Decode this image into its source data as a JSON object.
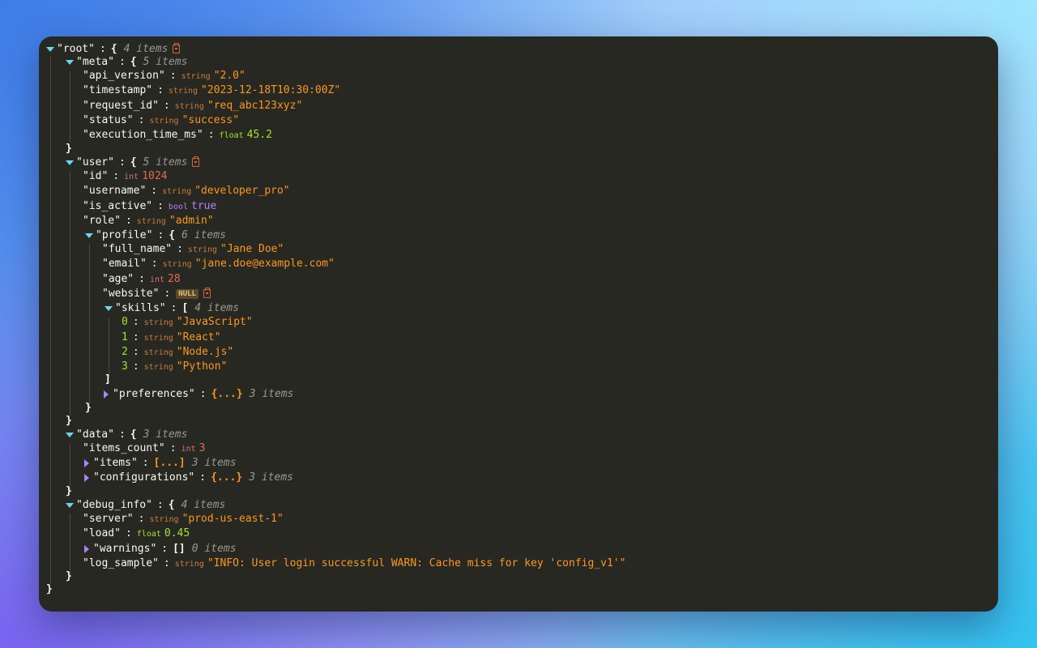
{
  "meta_counts": {
    "items_word": "items"
  },
  "root": {
    "key": "\"root\"",
    "open": "{",
    "close": "}",
    "count": "4 items"
  },
  "meta": {
    "key": "\"meta\"",
    "open": "{",
    "close": "}",
    "count": "5 items",
    "api_version": {
      "key": "\"api_version\"",
      "type": "string",
      "value": "\"2.0\""
    },
    "timestamp": {
      "key": "\"timestamp\"",
      "type": "string",
      "value": "\"2023-12-18T10:30:00Z\""
    },
    "request_id": {
      "key": "\"request_id\"",
      "type": "string",
      "value": "\"req_abc123xyz\""
    },
    "status": {
      "key": "\"status\"",
      "type": "string",
      "value": "\"success\""
    },
    "execution_time_ms": {
      "key": "\"execution_time_ms\"",
      "type": "float",
      "value": "45.2"
    }
  },
  "user": {
    "key": "\"user\"",
    "open": "{",
    "close": "}",
    "count": "5 items",
    "id": {
      "key": "\"id\"",
      "type": "int",
      "value": "1024"
    },
    "username": {
      "key": "\"username\"",
      "type": "string",
      "value": "\"developer_pro\""
    },
    "is_active": {
      "key": "\"is_active\"",
      "type": "bool",
      "value": "true"
    },
    "role": {
      "key": "\"role\"",
      "type": "string",
      "value": "\"admin\""
    },
    "profile": {
      "key": "\"profile\"",
      "open": "{",
      "close": "}",
      "count": "6 items",
      "full_name": {
        "key": "\"full_name\"",
        "type": "string",
        "value": "\"Jane Doe\""
      },
      "email": {
        "key": "\"email\"",
        "type": "string",
        "value": "\"jane.doe@example.com\""
      },
      "age": {
        "key": "\"age\"",
        "type": "int",
        "value": "28"
      },
      "website": {
        "key": "\"website\"",
        "badge": "NULL"
      },
      "skills": {
        "key": "\"skills\"",
        "open": "[",
        "close": "]",
        "count": "4 items",
        "items": [
          {
            "index": "0",
            "type": "string",
            "value": "\"JavaScript\""
          },
          {
            "index": "1",
            "type": "string",
            "value": "\"React\""
          },
          {
            "index": "2",
            "type": "string",
            "value": "\"Node.js\""
          },
          {
            "index": "3",
            "type": "string",
            "value": "\"Python\""
          }
        ]
      },
      "preferences": {
        "key": "\"preferences\"",
        "collapsed": "{...}",
        "count": "3 items"
      }
    }
  },
  "data": {
    "key": "\"data\"",
    "open": "{",
    "close": "}",
    "count": "3 items",
    "items_count": {
      "key": "\"items_count\"",
      "type": "int",
      "value": "3"
    },
    "items": {
      "key": "\"items\"",
      "collapsed": "[...]",
      "count": "3 items"
    },
    "configurations": {
      "key": "\"configurations\"",
      "collapsed": "{...}",
      "count": "3 items"
    }
  },
  "debug_info": {
    "key": "\"debug_info\"",
    "open": "{",
    "close": "}",
    "count": "4 items",
    "server": {
      "key": "\"server\"",
      "type": "string",
      "value": "\"prod-us-east-1\""
    },
    "load": {
      "key": "\"load\"",
      "type": "float",
      "value": "0.45"
    },
    "warnings": {
      "key": "\"warnings\"",
      "collapsed": "[]",
      "count": "0 items"
    },
    "log_sample": {
      "key": "\"log_sample\"",
      "type": "string",
      "value": "\"INFO: User login successful WARN: Cache miss for key 'config_v1'\""
    }
  },
  "colon": ":"
}
